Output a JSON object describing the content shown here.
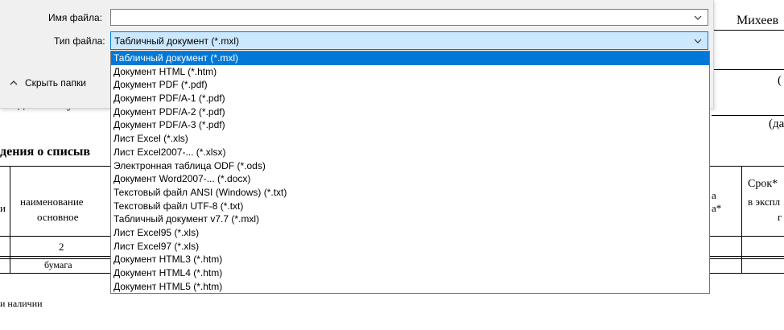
{
  "dialog": {
    "file_name_label": "Имя файла:",
    "file_name_value": "",
    "file_type_label": "Тип файла:",
    "file_type_value": "Табличный документ (*.mxl)",
    "hide_folders_label": "Скрыть папки"
  },
  "dropdown": {
    "options": [
      "Табличный документ (*.mxl)",
      "Документ HTML (*.htm)",
      "Документ PDF (*.pdf)",
      "Документ PDF/A-1 (*.pdf)",
      "Документ PDF/A-2 (*.pdf)",
      "Документ PDF/A-3 (*.pdf)",
      "Лист Excel (*.xls)",
      "Лист Excel2007-... (*.xlsx)",
      "Электронная таблица ODF (*.ods)",
      "Документ Word2007-... (*.docx)",
      "Текстовый файл ANSI (Windows) (*.txt)",
      "Текстовый файл UTF-8 (*.txt)",
      "Табличный документ v7.7 (*.mxl)",
      "Лист Excel95 (*.xls)",
      "Лист Excel97 (*.xls)",
      "Документ HTML3 (*.htm)",
      "Документ HTML4 (*.htm)",
      "Документ HTML5 (*.htm)"
    ],
    "selected_index": 0
  },
  "document": {
    "surname": "Михеев",
    "paren_1": "(",
    "text_ohodimost": "оходимость унич",
    "paren_da": "(да",
    "heading_partial": "дения о списыв",
    "col_ii": "и",
    "col_naim_1": "наименование",
    "col_naim_2": "основное",
    "col_a": "а",
    "col_a_star": "а*",
    "col_srok_1": "Срок*",
    "col_srok_2": "в экспл",
    "col_srok_3": "г",
    "num_2": "2",
    "cell_bumaga": "бумага",
    "footnote": "и наличии"
  }
}
